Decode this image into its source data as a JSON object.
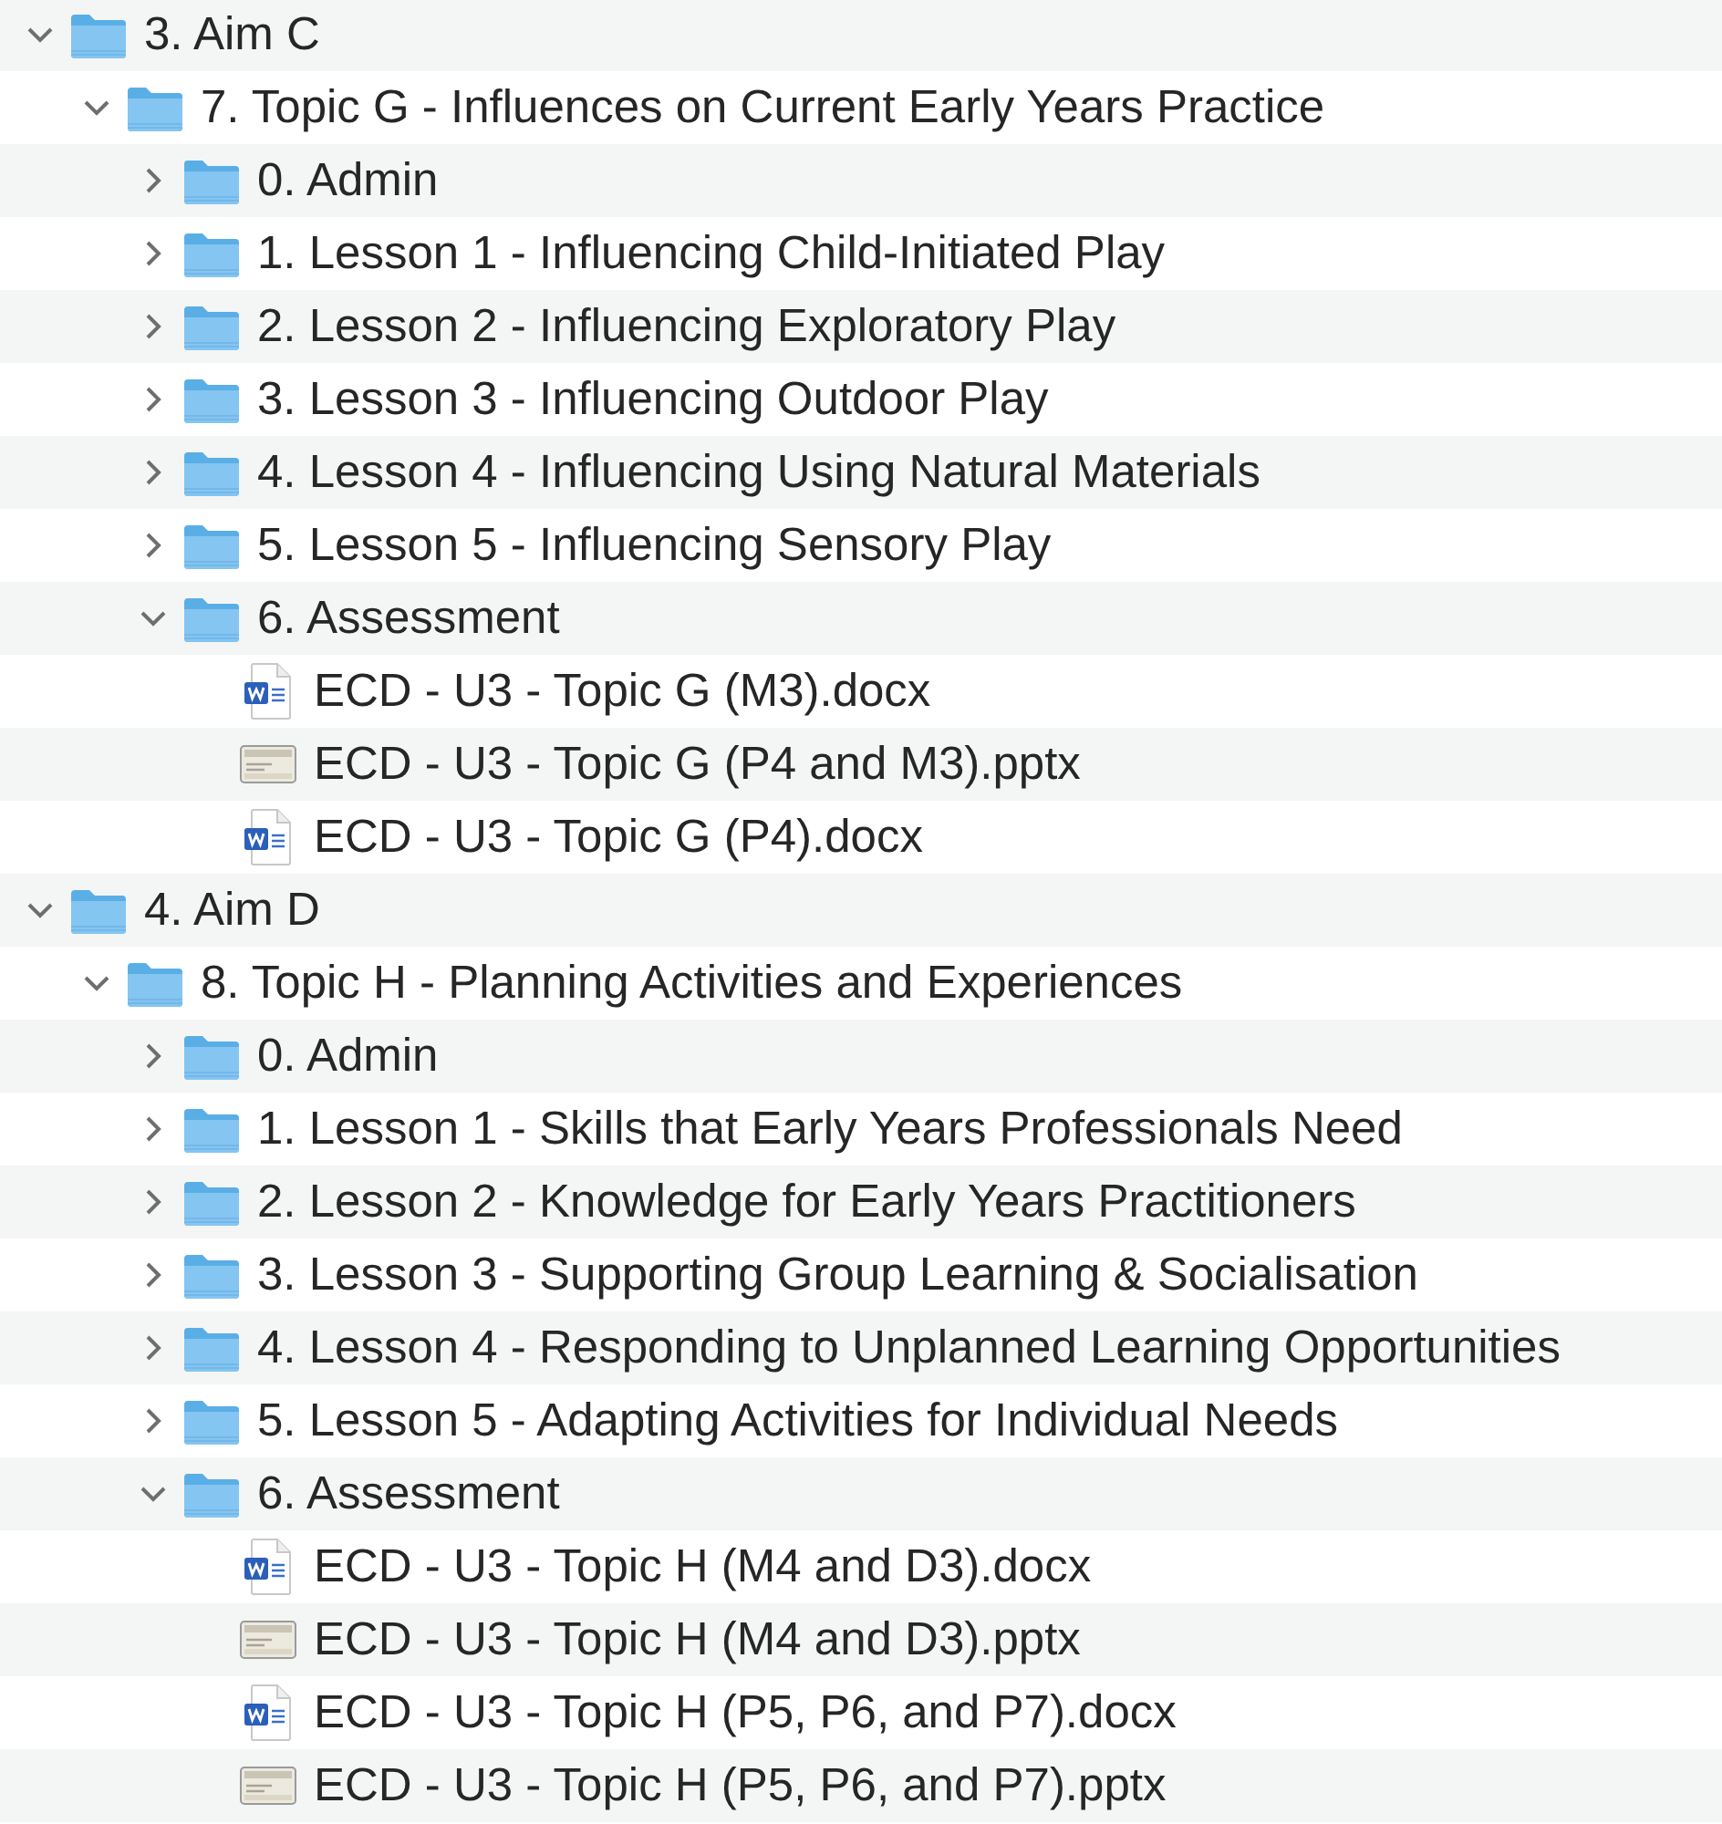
{
  "tree": [
    {
      "kind": "folder",
      "name": "3. Aim C",
      "expanded": true,
      "children": [
        {
          "kind": "folder",
          "name": "7. Topic G - Influences on Current Early Years Practice",
          "expanded": true,
          "children": [
            {
              "kind": "folder",
              "name": "0. Admin",
              "expanded": false
            },
            {
              "kind": "folder",
              "name": "1. Lesson 1 - Influencing Child-Initiated Play",
              "expanded": false
            },
            {
              "kind": "folder",
              "name": "2. Lesson 2 - Influencing Exploratory Play",
              "expanded": false
            },
            {
              "kind": "folder",
              "name": "3. Lesson 3 - Influencing Outdoor Play",
              "expanded": false
            },
            {
              "kind": "folder",
              "name": "4. Lesson 4 - Influencing Using Natural Materials",
              "expanded": false
            },
            {
              "kind": "folder",
              "name": "5. Lesson 5 - Influencing Sensory Play",
              "expanded": false
            },
            {
              "kind": "folder",
              "name": "6. Assessment",
              "expanded": true,
              "children": [
                {
                  "kind": "document",
                  "name": "ECD - U3 - Topic G (M3).docx"
                },
                {
                  "kind": "slides",
                  "name": "ECD - U3 - Topic G (P4 and M3).pptx"
                },
                {
                  "kind": "document",
                  "name": "ECD - U3 - Topic G (P4).docx"
                }
              ]
            }
          ]
        }
      ]
    },
    {
      "kind": "folder",
      "name": "4. Aim D",
      "expanded": true,
      "children": [
        {
          "kind": "folder",
          "name": "8. Topic H - Planning Activities and Experiences",
          "expanded": true,
          "children": [
            {
              "kind": "folder",
              "name": "0. Admin",
              "expanded": false
            },
            {
              "kind": "folder",
              "name": "1. Lesson 1 - Skills that Early Years Professionals Need",
              "expanded": false
            },
            {
              "kind": "folder",
              "name": "2. Lesson 2 - Knowledge for Early Years Practitioners",
              "expanded": false
            },
            {
              "kind": "folder",
              "name": "3. Lesson 3 - Supporting Group Learning & Socialisation",
              "expanded": false
            },
            {
              "kind": "folder",
              "name": "4. Lesson 4 - Responding to Unplanned Learning Opportunities",
              "expanded": false
            },
            {
              "kind": "folder",
              "name": "5. Lesson 5 - Adapting Activities for Individual Needs",
              "expanded": false
            },
            {
              "kind": "folder",
              "name": "6. Assessment",
              "expanded": true,
              "children": [
                {
                  "kind": "document",
                  "name": "ECD - U3 - Topic H (M4 and D3).docx"
                },
                {
                  "kind": "slides",
                  "name": "ECD - U3 - Topic H (M4 and D3).pptx"
                },
                {
                  "kind": "document",
                  "name": "ECD - U3 - Topic H (P5, P6, and P7).docx"
                },
                {
                  "kind": "slides",
                  "name": "ECD - U3 - Topic H (P5, P6, and P7).pptx"
                }
              ]
            }
          ]
        }
      ]
    }
  ]
}
